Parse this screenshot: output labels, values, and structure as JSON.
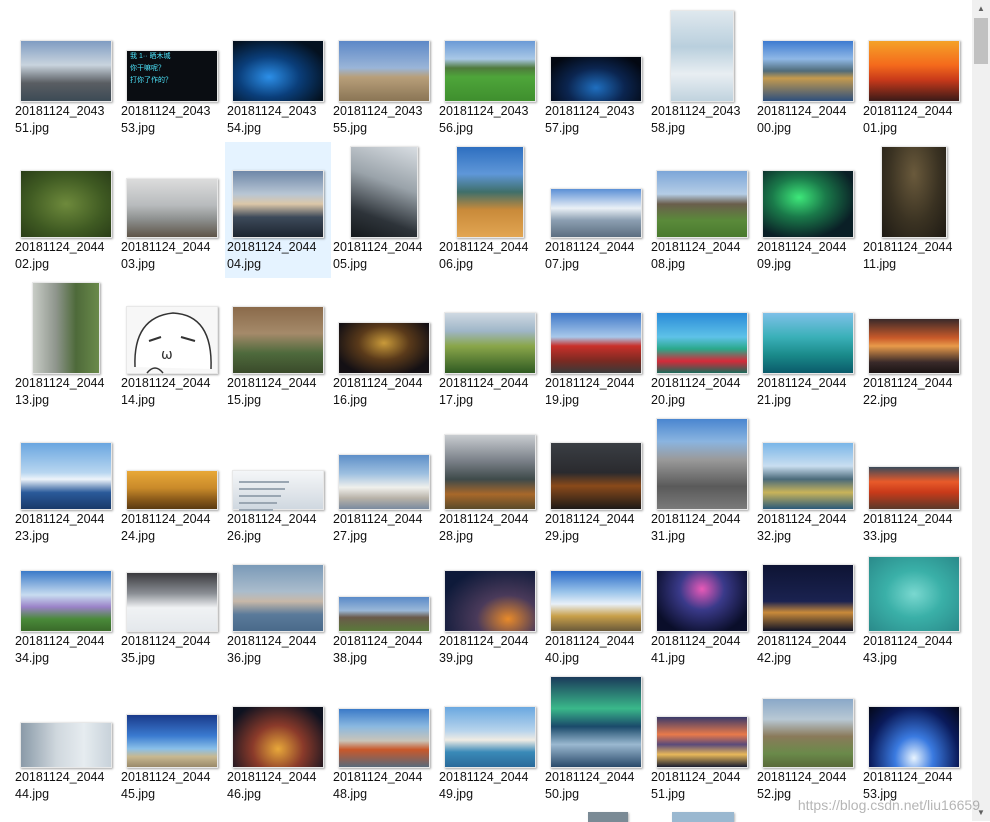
{
  "files": [
    {
      "l1": "20181124_2043",
      "l2": "51.jpg",
      "bg": "linear-gradient(180deg,#7f9cc2 0%,#c9d4de 40%,#5a5e63 70%,#3c4a55 100%)"
    },
    {
      "l1": "20181124_2043",
      "l2": "53.jpg",
      "bg": "#0a0d12",
      "cap": "我 1·· 晒木城\n你干嘛呢？\n打你了作的？",
      "capColor": "#4ee8ff"
    },
    {
      "l1": "20181124_2043",
      "l2": "54.jpg",
      "bg": "radial-gradient(ellipse at 40% 60%,#2c8fe8 0%,#0a3e7a 40%,#04111f 80%)"
    },
    {
      "l1": "20181124_2043",
      "l2": "55.jpg",
      "bg": "linear-gradient(180deg,#5d88c7 0%,#9ab5d8 45%,#b89f7a 60%,#8a7555 100%)"
    },
    {
      "l1": "20181124_2043",
      "l2": "56.jpg",
      "bg": "linear-gradient(180deg,#6b9ad6 0%,#a9c8e6 30%,#4f7a3c 45%,#4ea53a 60%,#3f8f2e 100%)"
    },
    {
      "l1": "20181124_2043",
      "l2": "57.jpg",
      "bg": "radial-gradient(ellipse at 50% 70%,#1f6fc0 0%,#0b2550 45%,#030812 85%)"
    },
    {
      "l1": "20181124_2043",
      "l2": "58.jpg",
      "bg": "linear-gradient(180deg,#dfe8ee 0%,#b9cfdd 40%,#e8eef2 70%,#c0d3de 100%)"
    },
    {
      "l1": "20181124_2044",
      "l2": "00.jpg",
      "bg": "linear-gradient(180deg,#3d7bd0 0%,#8fb8e6 30%,#4f6b7a 50%,#c49a4e 62%,#2d4f7d 100%)"
    },
    {
      "l1": "20181124_2044",
      "l2": "01.jpg",
      "bg": "linear-gradient(180deg,#f4a228 0%,#f46a1c 40%,#c7391a 65%,#3a1a18 100%)"
    },
    {
      "l1": "20181124_2044",
      "l2": "02.jpg",
      "bg": "radial-gradient(ellipse at 50% 50%,#6e8a3c 0%,#3f5a22 60%,#2a3d18 100%)"
    },
    {
      "l1": "20181124_2044",
      "l2": "03.jpg",
      "bg": "linear-gradient(180deg,#dcdcdc 0%,#b8bbbd 45%,#8c8f8e 70%,#5e5448 100%)"
    },
    {
      "l1": "20181124_2044",
      "l2": "04.jpg",
      "bg": "linear-gradient(180deg,#6e87a8 0%,#b8c6d4 35%,#dcc7a8 50%,#3d4a5a 70%,#1d2530 100%)",
      "selected": true
    },
    {
      "l1": "20181124_2044",
      "l2": "05.jpg",
      "bg": "linear-gradient(200deg,#d8dde2 0%,#9aa3aa 40%,#2e343a 75%,#15191c 100%)"
    },
    {
      "l1": "20181124_2044",
      "l2": "06.jpg",
      "bg": "linear-gradient(180deg,#2e6fc0 0%,#5f97d8 30%,#3f6f6a 50%,#c98a3a 70%,#e2a552 100%)"
    },
    {
      "l1": "20181124_2044",
      "l2": "07.jpg",
      "bg": "linear-gradient(180deg,#5b8fd6 0%,#eaf0f6 40%,#8c9fb2 65%,#5c6e80 100%)"
    },
    {
      "l1": "20181124_2044",
      "l2": "08.jpg",
      "bg": "linear-gradient(180deg,#7da6d8 0%,#b5cde6 35%,#6a5e4c 50%,#5a8a3a 75%,#4a7a2e 100%)"
    },
    {
      "l1": "20181124_2044",
      "l2": "09.jpg",
      "bg": "radial-gradient(ellipse at 40% 40%,#3ee87a 0%,#1a7a4a 35%,#0a1f26 75%)"
    },
    {
      "l1": "20181124_2044",
      "l2": "11.jpg",
      "bg": "radial-gradient(ellipse at 50% 30%,#6a5a3c 0%,#3a3222 55%,#1e1a14 100%)"
    },
    {
      "l1": "20181124_2044",
      "l2": "13.jpg",
      "bg": "linear-gradient(90deg,#c8ccc6 0%,#8e958c 35%,#4e6a3a 65%,#6a8a4a 100%)"
    },
    {
      "l1": "20181124_2044",
      "l2": "14.jpg",
      "bg": "#f7f7f7",
      "face": true
    },
    {
      "l1": "20181124_2044",
      "l2": "15.jpg",
      "bg": "linear-gradient(180deg,#8a6a4a 0%,#a58a6a 40%,#4e6a3c 70%,#3a4a2a 100%)"
    },
    {
      "l1": "20181124_2044",
      "l2": "16.jpg",
      "bg": "radial-gradient(ellipse at 50% 40%,#c99a3a 0%,#5a3a1a 40%,#141014 80%)"
    },
    {
      "l1": "20181124_2044",
      "l2": "17.jpg",
      "bg": "linear-gradient(180deg,#cfd9e2 0%,#9fb6c8 30%,#8aa64a 55%,#2f5a22 100%)"
    },
    {
      "l1": "20181124_2044",
      "l2": "19.jpg",
      "bg": "linear-gradient(180deg,#3f78c8 0%,#a8c8ea 40%,#c9302a 55%,#7a2a22 80%,#3a3a3a 100%)"
    },
    {
      "l1": "20181124_2044",
      "l2": "20.jpg",
      "bg": "linear-gradient(180deg,#2a8ad8 0%,#5ec2e8 40%,#2aa88a 60%,#d62a3a 80%,#1a6a5a 100%)"
    },
    {
      "l1": "20181124_2044",
      "l2": "21.jpg",
      "bg": "linear-gradient(180deg,#7ec0e8 0%,#3ab0b8 40%,#1a8a8a 70%,#0a5a6a 100%)"
    },
    {
      "l1": "20181124_2044",
      "l2": "22.jpg",
      "bg": "linear-gradient(180deg,#3a2a2a 0%,#c95a2a 35%,#e89a4a 50%,#3a2a2a 80%,#1a1414 100%)"
    },
    {
      "l1": "20181124_2044",
      "l2": "23.jpg",
      "bg": "linear-gradient(180deg,#6aa6e0 0%,#b8d6f0 45%,#eef4fa 55%,#2a5a9a 75%,#1a3a6a 100%)"
    },
    {
      "l1": "20181124_2044",
      "l2": "24.jpg",
      "bg": "linear-gradient(180deg,#e8a838 0%,#c98a2a 45%,#8a5a1a 75%,#5a3a12 100%)"
    },
    {
      "l1": "20181124_2044",
      "l2": "26.jpg",
      "bg": "linear-gradient(180deg,#f4f6f8 0%,#e6eaee 40%,#d0d8e0 100%)",
      "doc": true
    },
    {
      "l1": "20181124_2044",
      "l2": "27.jpg",
      "bg": "linear-gradient(180deg,#5e8fc8 0%,#9ec0e0 35%,#f0f0ec 60%,#b8b2a8 80%,#7a8aa0 100%)"
    },
    {
      "l1": "20181124_2044",
      "l2": "28.jpg",
      "bg": "linear-gradient(180deg,#c8ccd0 0%,#7a8088 35%,#3e4a4a 60%,#a8682a 80%,#5a4a2a 100%)"
    },
    {
      "l1": "20181124_2044",
      "l2": "29.jpg",
      "bg": "linear-gradient(180deg,#3a3e44 0%,#2a2a2e 45%,#8a4a1a 65%,#1e1a18 100%)"
    },
    {
      "l1": "20181124_2044",
      "l2": "31.jpg",
      "bg": "linear-gradient(180deg,#4a86d0 0%,#8ab4e0 25%,#9a9a9a 45%,#5a5a5a 75%,#7a7a7a 100%)"
    },
    {
      "l1": "20181124_2044",
      "l2": "32.jpg",
      "bg": "linear-gradient(180deg,#7ab6e8 0%,#c9def0 35%,#4a6a7a 55%,#c9b45a 75%,#2a5a7a 100%)"
    },
    {
      "l1": "20181124_2044",
      "l2": "33.jpg",
      "bg": "linear-gradient(180deg,#3a4a5a 0%,#e85a2a 35%,#c93a1a 60%,#5a3a2a 100%)"
    },
    {
      "l1": "20181124_2044",
      "l2": "34.jpg",
      "bg": "linear-gradient(180deg,#3a7ac8 0%,#c8dcf0 40%,#9a82c8 60%,#4a8a3a 80%,#3a6a2a 100%)"
    },
    {
      "l1": "20181124_2044",
      "l2": "35.jpg",
      "bg": "linear-gradient(180deg,#3a3a3e 0%,#8a8e94 35%,#f0f2f4 60%,#e4e8ec 100%)"
    },
    {
      "l1": "20181124_2044",
      "l2": "36.jpg",
      "bg": "linear-gradient(180deg,#7a9ab8 0%,#aabccc 40%,#c8b8a8 55%,#5a7a9a 75%,#4a6a8a 100%)"
    },
    {
      "l1": "20181124_2044",
      "l2": "38.jpg",
      "bg": "linear-gradient(180deg,#5a8ac8 0%,#9ab8d8 40%,#6a5a4a 60%,#5a7a3a 100%)"
    },
    {
      "l1": "20181124_2044",
      "l2": "39.jpg",
      "bg": "radial-gradient(ellipse at 70% 80%,#e88a2a 0%,#4a3a5a 35%,#0e1a3a 80%)"
    },
    {
      "l1": "20181124_2044",
      "l2": "40.jpg",
      "bg": "linear-gradient(180deg,#2a6ac8 0%,#9ac4ea 35%,#e8f0f8 55%,#c9a04a 75%,#6a5a3a 100%)"
    },
    {
      "l1": "20181124_2044",
      "l2": "41.jpg",
      "bg": "radial-gradient(ellipse at 50% 30%,#e85ab8 0%,#3a3a8a 35%,#0a0e2a 80%)"
    },
    {
      "l1": "20181124_2044",
      "l2": "42.jpg",
      "bg": "linear-gradient(180deg,#0e1434 0%,#1a2250 55%,#c98a3a 72%,#0e1226 100%)"
    },
    {
      "l1": "20181124_2044",
      "l2": "43.jpg",
      "bg": "radial-gradient(ellipse at 50% 50%,#7ad8d0 0%,#3ab0a8 45%,#2a8a8a 100%)"
    },
    {
      "l1": "20181124_2044",
      "l2": "44.jpg",
      "bg": "linear-gradient(90deg,#8a9aa8 0%,#d0d8de 40%,#e6ecf0 70%,#c8d2da 100%)"
    },
    {
      "l1": "20181124_2044",
      "l2": "45.jpg",
      "bg": "linear-gradient(180deg,#1a3a8a 0%,#3a7ad0 40%,#8ac0e8 65%,#c8b890 80%,#9a8a6a 100%)"
    },
    {
      "l1": "20181124_2044",
      "l2": "46.jpg",
      "bg": "radial-gradient(ellipse at 50% 70%,#e8a83a 0%,#8a3a2a 40%,#0e1220 85%)"
    },
    {
      "l1": "20181124_2044",
      "l2": "48.jpg",
      "bg": "linear-gradient(180deg,#3a7ac8 0%,#8ab8e0 30%,#c9c4b8 55%,#c9582a 70%,#5a6a7a 100%)"
    },
    {
      "l1": "20181124_2044",
      "l2": "49.jpg",
      "bg": "linear-gradient(180deg,#6aa8e0 0%,#b8d4ec 40%,#f0ece4 55%,#3a8ab8 75%,#2a6a9a 100%)"
    },
    {
      "l1": "20181124_2044",
      "l2": "50.jpg",
      "bg": "linear-gradient(180deg,#1a3a5a 0%,#3ab88a 35%,#1a4a6a 55%,#9ab8d0 75%,#2a4a6a 100%)"
    },
    {
      "l1": "20181124_2044",
      "l2": "51.jpg",
      "bg": "linear-gradient(180deg,#3a3a6a 0%,#e87a4a 35%,#5a4a7a 55%,#e8b85a 75%,#1a1e30 100%)"
    },
    {
      "l1": "20181124_2044",
      "l2": "52.jpg",
      "bg": "linear-gradient(180deg,#8aa8c8 0%,#b8c8d4 30%,#8a7a5a 55%,#6a8a4a 80%,#5a6a3a 100%)"
    },
    {
      "l1": "20181124_2044",
      "l2": "53.jpg",
      "bg": "radial-gradient(ellipse at 50% 85%,#e8f4ff 0%,#3a7ae0 30%,#0a1a5a 70%,#040818 100%)"
    }
  ],
  "watermark": "https://blog.csdn.net/liu16659"
}
